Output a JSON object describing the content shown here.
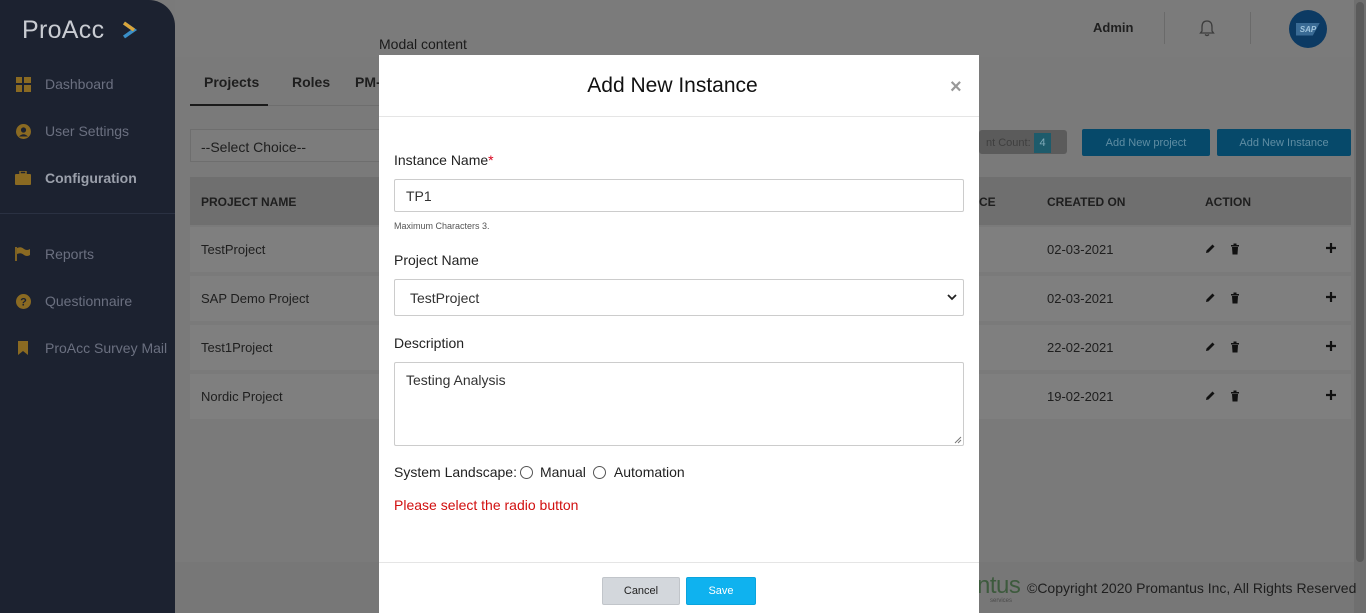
{
  "sidebar": {
    "logo_text": "ProAcc",
    "items": [
      {
        "label": "Dashboard",
        "icon": "grid-icon"
      },
      {
        "label": "User Settings",
        "icon": "user-icon"
      },
      {
        "label": "Configuration",
        "icon": "briefcase-icon",
        "active": true
      },
      {
        "label": "Reports",
        "icon": "flag-icon"
      },
      {
        "label": "Questionnaire",
        "icon": "question-icon"
      },
      {
        "label": "ProAcc Survey Mail",
        "icon": "bookmark-icon"
      }
    ]
  },
  "header": {
    "user": "Admin",
    "avatar_text": "SAP"
  },
  "overlay_label": "Modal content",
  "tabs": [
    "Projects",
    "Roles",
    "PM-"
  ],
  "filters": {
    "select_choice": "--Select Choice--",
    "count_label": "nt Count:",
    "count_value": "4",
    "add_project_label": "Add New project",
    "add_instance_label": "Add New Instance"
  },
  "table": {
    "headers": [
      "PROJECT NAME",
      "CE",
      "CREATED ON",
      "ACTION"
    ],
    "rows": [
      {
        "project": "TestProject",
        "created": "02-03-2021"
      },
      {
        "project": "SAP Demo Project",
        "created": "02-03-2021"
      },
      {
        "project": "Test1Project",
        "created": "22-02-2021"
      },
      {
        "project": "Nordic Project",
        "created": "19-02-2021"
      }
    ]
  },
  "footer": {
    "brand": "ntus",
    "brand_sub": "services",
    "copyright": "©Copyright 2020 Promantus Inc, All Rights Reserved"
  },
  "modal": {
    "title": "Add New Instance",
    "close": "×",
    "instance_name_label": "Instance Name",
    "required_mark": "*",
    "instance_name_value": "TP1",
    "instance_hint": "Maximum Characters 3.",
    "project_name_label": "Project Name",
    "project_name_value": "TestProject",
    "description_label": "Description",
    "description_value": "Testing Analysis",
    "landscape_label": "System Landscape:",
    "landscape_options": [
      "Manual",
      "Automation"
    ],
    "error_text": "Please select the radio button",
    "cancel_label": "Cancel",
    "save_label": "Save"
  }
}
